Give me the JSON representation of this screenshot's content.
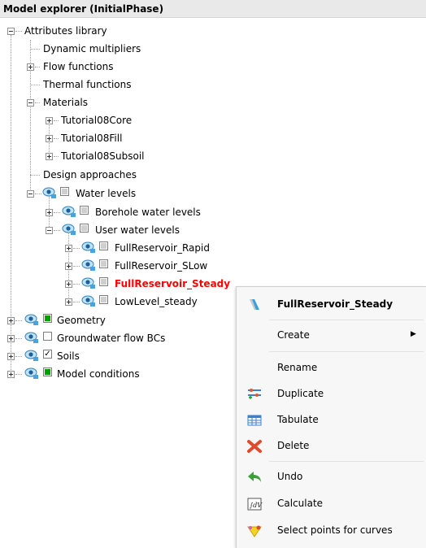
{
  "panel": {
    "title": "Model explorer (InitialPhase)"
  },
  "tree": {
    "attributes_library": "Attributes library",
    "dynamic_multipliers": "Dynamic multipliers",
    "flow_functions": "Flow functions",
    "thermal_functions": "Thermal functions",
    "materials": "Materials",
    "materials_items": [
      "Tutorial08Core",
      "Tutorial08Fill",
      "Tutorial08Subsoil"
    ],
    "design_approaches": "Design approaches",
    "water_levels": "Water levels",
    "borehole_water_levels": "Borehole water levels",
    "user_water_levels": "User water levels",
    "user_water_items": [
      "FullReservoir_Rapid",
      "FullReservoir_SLow",
      "FullReservoir_Steady",
      "LowLevel_steady"
    ],
    "geometry": "Geometry",
    "groundwater_flow_bcs": "Groundwater flow BCs",
    "soils": "Soils",
    "model_conditions": "Model conditions"
  },
  "context_menu": {
    "header": "FullReservoir_Steady",
    "create": "Create",
    "rename": "Rename",
    "duplicate": "Duplicate",
    "tabulate": "Tabulate",
    "delete": "Delete",
    "undo": "Undo",
    "calculate": "Calculate",
    "select_points": "Select points for curves"
  },
  "colors": {
    "highlight_text": "#ff0000",
    "active_checkbox": "#00a000"
  }
}
